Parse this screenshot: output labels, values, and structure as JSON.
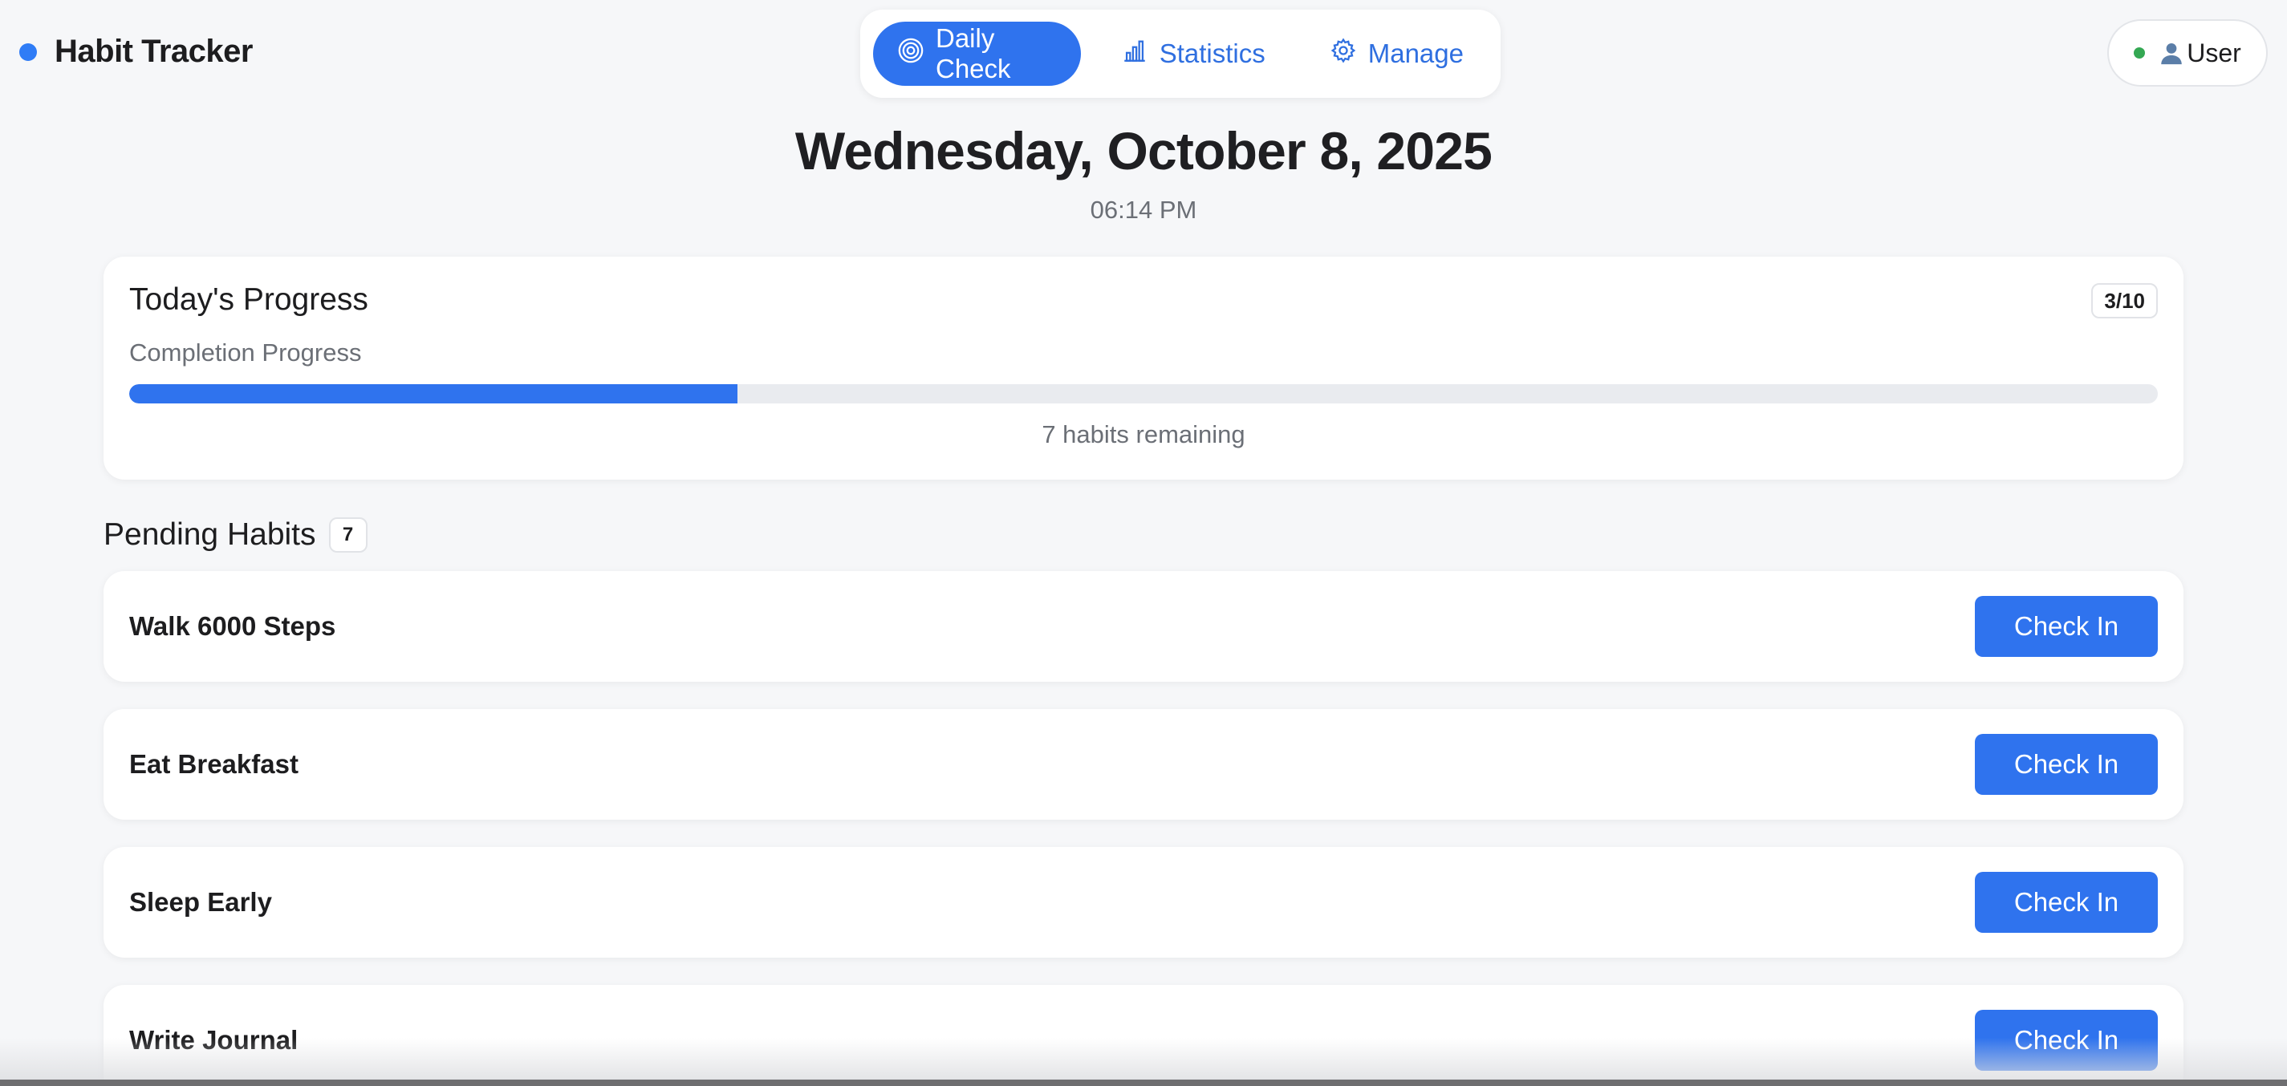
{
  "app": {
    "title": "Habit Tracker",
    "accent_color": "#2f73ee"
  },
  "nav": {
    "tabs": [
      {
        "label": "Daily Check",
        "icon": "target-icon",
        "active": true
      },
      {
        "label": "Statistics",
        "icon": "bar-chart-icon",
        "active": false
      },
      {
        "label": "Manage",
        "icon": "gear-icon",
        "active": false
      }
    ]
  },
  "user": {
    "label": "User",
    "status": "online",
    "status_color": "#34a853"
  },
  "date": {
    "heading": "Wednesday, October 8, 2025",
    "time": "06:14 PM"
  },
  "progress": {
    "title": "Today's Progress",
    "badge": "3/10",
    "label": "Completion Progress",
    "completed": 3,
    "total": 10,
    "remaining_text": "7 habits remaining"
  },
  "pending": {
    "title": "Pending Habits",
    "count": "7",
    "button_label": "Check In",
    "habits": [
      {
        "name": "Walk 6000 Steps"
      },
      {
        "name": "Eat Breakfast"
      },
      {
        "name": "Sleep Early"
      },
      {
        "name": "Write Journal"
      }
    ]
  }
}
